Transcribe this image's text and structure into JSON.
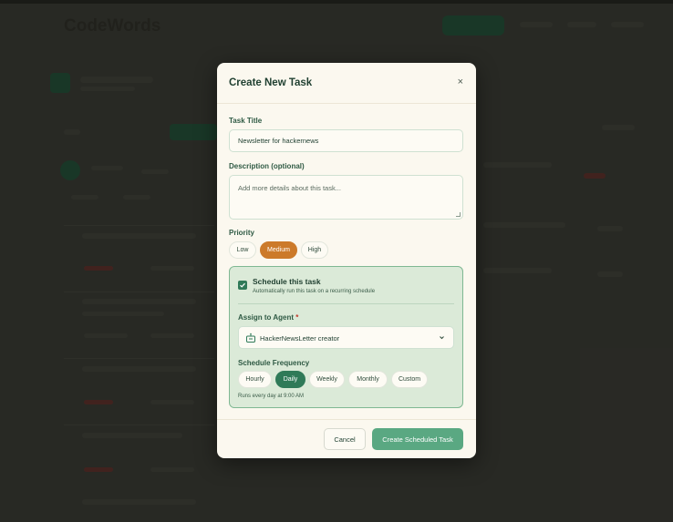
{
  "background": {
    "app_name": "CodeWords"
  },
  "modal": {
    "title": "Create New Task",
    "close_label": "×",
    "task_title_label": "Task Title",
    "task_title_value": "Newsletter for hackernews",
    "description_label": "Description (optional)",
    "description_placeholder": "Add more details about this task...",
    "priority_label": "Priority",
    "priority_options": [
      "Low",
      "Medium",
      "High"
    ],
    "priority_selected": "Medium",
    "schedule": {
      "checked": true,
      "title": "Schedule this task",
      "subtitle": "Automatically run this task on a recurring schedule",
      "agent_label": "Assign to Agent",
      "agent_required_mark": "*",
      "agent_value": "HackerNewsLetter creator",
      "agent_icon": "robot-icon",
      "frequency_label": "Schedule Frequency",
      "frequency_options": [
        "Hourly",
        "Daily",
        "Weekly",
        "Monthly",
        "Custom"
      ],
      "frequency_selected": "Daily",
      "note": "Runs every day at 9:00 AM"
    },
    "cancel_label": "Cancel",
    "submit_label": "Create Scheduled Task"
  },
  "colors": {
    "accent_green": "#2f7a58",
    "accent_orange": "#cc7a2a",
    "submit_green": "#5aa882"
  }
}
